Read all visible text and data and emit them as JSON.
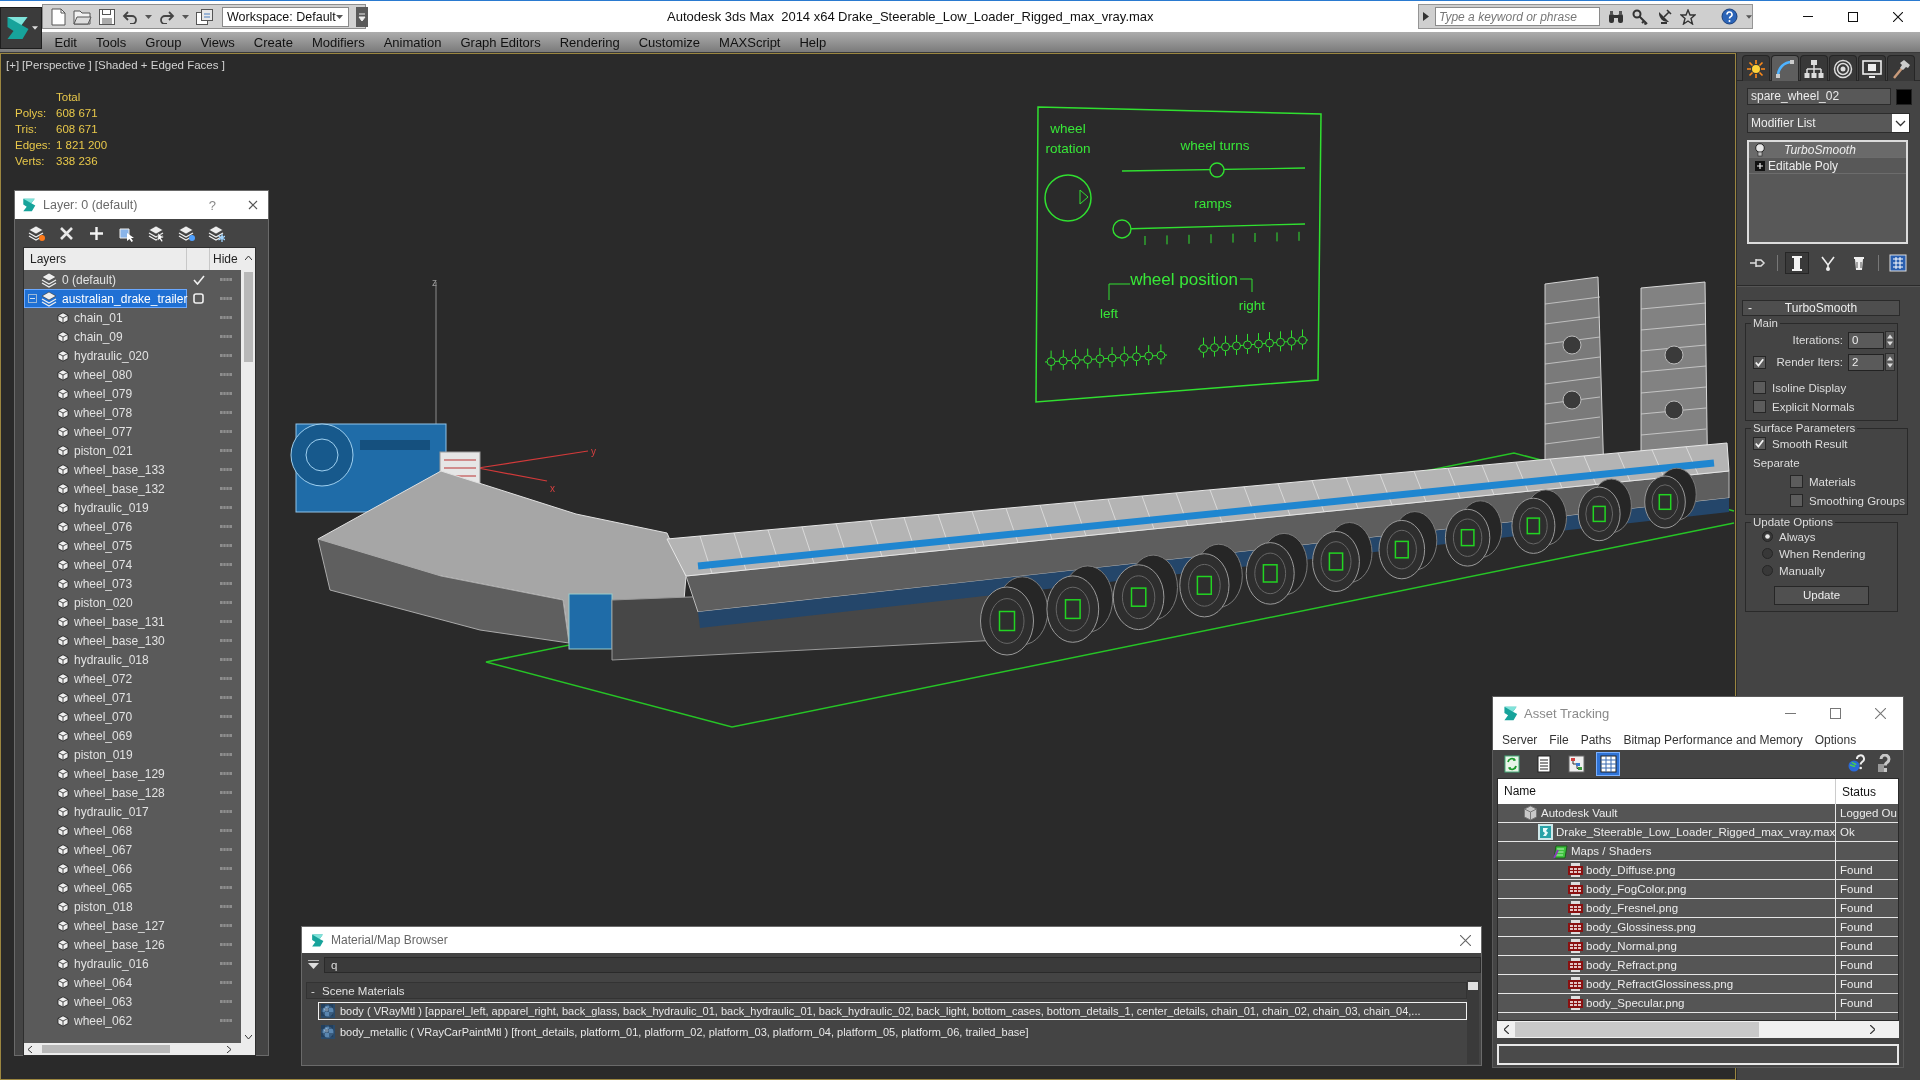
{
  "title_bar": {
    "workspace": "Workspace: Default",
    "app_title": "Autodesk 3ds Max  2014 x64",
    "file_title": "Drake_Steerable_Low_Loader_Rigged_max_vray.max",
    "search": {
      "placeholder": "Type a keyword or phrase"
    }
  },
  "menu": [
    "Edit",
    "Tools",
    "Group",
    "Views",
    "Create",
    "Modifiers",
    "Animation",
    "Graph Editors",
    "Rendering",
    "Customize",
    "MAXScript",
    "Help"
  ],
  "viewport": {
    "labels": [
      "[+]",
      "[Perspective ]",
      "[Shaded + Edged Faces ]"
    ],
    "stats": {
      "header": "Total",
      "rows": [
        {
          "label": "Polys:",
          "value": "608 671"
        },
        {
          "label": "Tris:",
          "value": "608 671"
        },
        {
          "label": "Edges:",
          "value": "1 821 200"
        },
        {
          "label": "Verts:",
          "value": "338 236"
        }
      ]
    },
    "axis_labels": [
      "z",
      "y",
      "x"
    ],
    "rig_panel": {
      "rotation_label": [
        "wheel",
        "rotation"
      ],
      "turns_label": "wheel turns",
      "ramps_label": "ramps",
      "position_label": "wheel position",
      "left_label": "left",
      "right_label": "right"
    }
  },
  "layer_panel": {
    "title": "Layer: 0 (default)",
    "help": "?",
    "columns": [
      "Layers",
      "Hide"
    ],
    "layers": [
      {
        "name": "0 (default)",
        "current": true,
        "selected": false,
        "hidden": false
      },
      {
        "name": "australian_drake_trailer",
        "current": false,
        "selected": true,
        "hidden": false,
        "expanded": true,
        "children": [
          {
            "name": "chain_01",
            "selected": false,
            "hidden": false
          },
          {
            "name": "chain_09",
            "selected": false,
            "hidden": false
          },
          {
            "name": "hydraulic_020",
            "selected": false,
            "hidden": false
          },
          {
            "name": "wheel_080",
            "selected": false,
            "hidden": false
          },
          {
            "name": "wheel_079",
            "selected": false,
            "hidden": false
          },
          {
            "name": "wheel_078",
            "selected": false,
            "hidden": false
          },
          {
            "name": "wheel_077",
            "selected": false,
            "hidden": false
          },
          {
            "name": "piston_021",
            "selected": false,
            "hidden": false
          },
          {
            "name": "wheel_base_133",
            "selected": false,
            "hidden": false
          },
          {
            "name": "wheel_base_132",
            "selected": false,
            "hidden": false
          },
          {
            "name": "hydraulic_019",
            "selected": false,
            "hidden": false
          },
          {
            "name": "wheel_076",
            "selected": false,
            "hidden": false
          },
          {
            "name": "wheel_075",
            "selected": false,
            "hidden": false
          },
          {
            "name": "wheel_074",
            "selected": false,
            "hidden": false
          },
          {
            "name": "wheel_073",
            "selected": false,
            "hidden": false
          },
          {
            "name": "piston_020",
            "selected": false,
            "hidden": false
          },
          {
            "name": "wheel_base_131",
            "selected": false,
            "hidden": false
          },
          {
            "name": "wheel_base_130",
            "selected": false,
            "hidden": false
          },
          {
            "name": "hydraulic_018",
            "selected": false,
            "hidden": false
          },
          {
            "name": "wheel_072",
            "selected": false,
            "hidden": false
          },
          {
            "name": "wheel_071",
            "selected": false,
            "hidden": false
          },
          {
            "name": "wheel_070",
            "selected": false,
            "hidden": false
          },
          {
            "name": "wheel_069",
            "selected": false,
            "hidden": false
          },
          {
            "name": "piston_019",
            "selected": false,
            "hidden": false
          },
          {
            "name": "wheel_base_129",
            "selected": false,
            "hidden": false
          },
          {
            "name": "wheel_base_128",
            "selected": false,
            "hidden": false
          },
          {
            "name": "hydraulic_017",
            "selected": false,
            "hidden": false
          },
          {
            "name": "wheel_068",
            "selected": false,
            "hidden": false
          },
          {
            "name": "wheel_067",
            "selected": false,
            "hidden": false
          },
          {
            "name": "wheel_066",
            "selected": false,
            "hidden": false
          },
          {
            "name": "wheel_065",
            "selected": false,
            "hidden": false
          },
          {
            "name": "piston_018",
            "selected": false,
            "hidden": false
          },
          {
            "name": "wheel_base_127",
            "selected": false,
            "hidden": false
          },
          {
            "name": "wheel_base_126",
            "selected": false,
            "hidden": false
          },
          {
            "name": "hydraulic_016",
            "selected": false,
            "hidden": false
          },
          {
            "name": "wheel_064",
            "selected": false,
            "hidden": false
          },
          {
            "name": "wheel_063",
            "selected": false,
            "hidden": false
          },
          {
            "name": "wheel_062",
            "selected": false,
            "hidden": false
          }
        ]
      }
    ]
  },
  "command_panel": {
    "tabs": [
      {
        "selected": false
      },
      {
        "selected": true
      },
      {
        "selected": false
      },
      {
        "selected": false
      },
      {
        "selected": false
      },
      {
        "selected": false
      }
    ],
    "object_name": "spare_wheel_02",
    "modifier_list": "Modifier List",
    "stack": [
      {
        "name": "TurboSmooth",
        "kind": "modifier",
        "selected": true,
        "viewport_enabled": false
      },
      {
        "name": "Editable Poly",
        "kind": "object",
        "selected": false,
        "expanded": false
      }
    ],
    "stack_tools": [
      {
        "on": false
      },
      {
        "on": true
      },
      {
        "on": false
      },
      {
        "on": false
      },
      {
        "on": false
      }
    ],
    "rollout": {
      "toggle": "-",
      "title": "TurboSmooth",
      "groups": [
        {
          "title": "Main",
          "controls": [
            {
              "kind": "spinner",
              "label": "Iterations:",
              "value": "0"
            },
            {
              "kind": "spinner",
              "label": "Render Iters:",
              "checked": true,
              "value": "2"
            },
            {
              "kind": "checkbox",
              "label": "Isoline Display",
              "checked": false
            },
            {
              "kind": "checkbox",
              "label": "Explicit Normals",
              "checked": false
            }
          ]
        },
        {
          "title": "Surface Parameters",
          "controls": [
            {
              "kind": "checkbox",
              "label": "Smooth Result",
              "checked": true
            },
            {
              "kind": "label",
              "label": "Separate",
              "children": [
                {
                  "kind": "checkbox",
                  "label": "Materials",
                  "checked": false
                },
                {
                  "kind": "checkbox",
                  "label": "Smoothing Groups",
                  "checked": false
                }
              ]
            }
          ]
        },
        {
          "title": "Update Options",
          "controls": [
            {
              "kind": "radio",
              "label": "Always",
              "selected": true
            },
            {
              "kind": "radio",
              "label": "When Rendering",
              "selected": false
            },
            {
              "kind": "radio",
              "label": "Manually",
              "selected": false
            },
            {
              "kind": "button",
              "label": "Update"
            }
          ]
        }
      ]
    }
  },
  "asset_tracking": {
    "title": "Asset Tracking",
    "menu": [
      "Server",
      "File",
      "Paths",
      "Bitmap Performance and Memory",
      "Options"
    ],
    "view_buttons": [
      {
        "selected": false
      },
      {
        "selected": false
      },
      {
        "selected": false
      },
      {
        "selected": true
      }
    ],
    "columns": [
      "Name",
      "Status"
    ],
    "assets": [
      {
        "kind": "vault",
        "name": "Autodesk Vault",
        "status": "Logged Ou",
        "children": [
          {
            "kind": "scene",
            "name": "Drake_Steerable_Low_Loader_Rigged_max_vray.max",
            "status": "Ok",
            "children": [
              {
                "kind": "folder",
                "name": "Maps / Shaders",
                "children": [
                  {
                    "kind": "image",
                    "name": "body_Diffuse.png",
                    "status": "Found"
                  },
                  {
                    "kind": "image",
                    "name": "body_FogColor.png",
                    "status": "Found"
                  },
                  {
                    "kind": "image",
                    "name": "body_Fresnel.png",
                    "status": "Found"
                  },
                  {
                    "kind": "image",
                    "name": "body_Glossiness.png",
                    "status": "Found"
                  },
                  {
                    "kind": "image",
                    "name": "body_Normal.png",
                    "status": "Found"
                  },
                  {
                    "kind": "image",
                    "name": "body_Refract.png",
                    "status": "Found"
                  },
                  {
                    "kind": "image",
                    "name": "body_RefractGlossiness.png",
                    "status": "Found"
                  },
                  {
                    "kind": "image",
                    "name": "body_Specular.png",
                    "status": "Found"
                  }
                ]
              }
            ]
          }
        ]
      }
    ]
  },
  "material_browser": {
    "title": "Material/Map Browser",
    "search": {
      "value": "q"
    },
    "groups": [
      {
        "toggle": "-",
        "title": "Scene Materials",
        "materials": [
          {
            "text": "body ( VRayMtl ) [apparel_left, apparel_right, back_glass, back_hydraulic_01, back_hydraulic_01, back_hydraulic_02, back_light, bottom_cases, bottom_details_1, center_details, chain_01, chain_02, chain_03, chain_04,...",
            "selected": true
          },
          {
            "text": "body_metallic ( VRayCarPaintMtl ) [front_details, platform_01, platform_02, platform_03, platform_04, platform_05, platform_06, trailed_base]",
            "selected": false
          }
        ]
      }
    ]
  }
}
